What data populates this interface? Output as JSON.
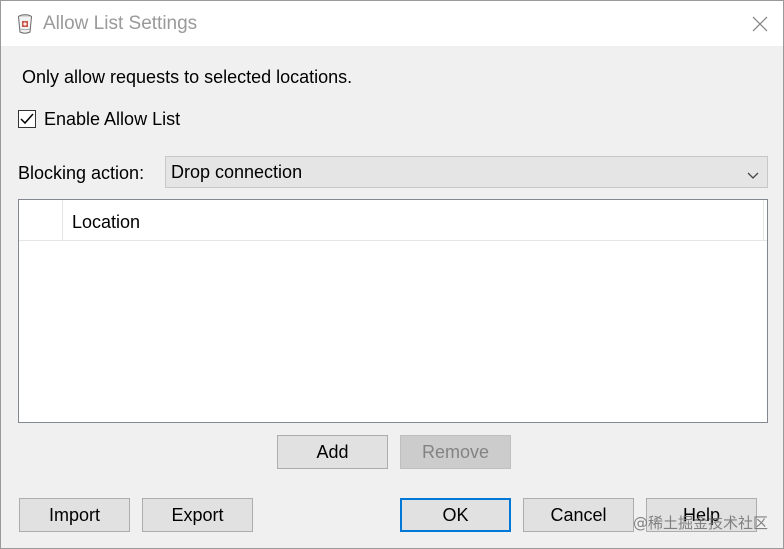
{
  "window": {
    "title": "Allow List Settings",
    "app_icon": "bucket-icon",
    "close_icon": "close-icon"
  },
  "description": "Only allow requests to selected locations.",
  "enable_allow_list": {
    "label": "Enable Allow List",
    "checked": true
  },
  "blocking_action": {
    "label": "Blocking action:",
    "selected": "Drop connection",
    "arrow_icon": "chevron-down-icon"
  },
  "list": {
    "columns": [
      "",
      "Location"
    ],
    "rows": []
  },
  "buttons": {
    "add": "Add",
    "remove": "Remove",
    "import": "Import",
    "export": "Export",
    "ok": "OK",
    "cancel": "Cancel",
    "help": "Help"
  },
  "watermark": "@稀土掘金技术社区",
  "colors": {
    "title_text": "#9a9a9a",
    "window_bg": "#f0f0f0",
    "default_button_border": "#0078d7",
    "disabled_text": "#838383"
  }
}
